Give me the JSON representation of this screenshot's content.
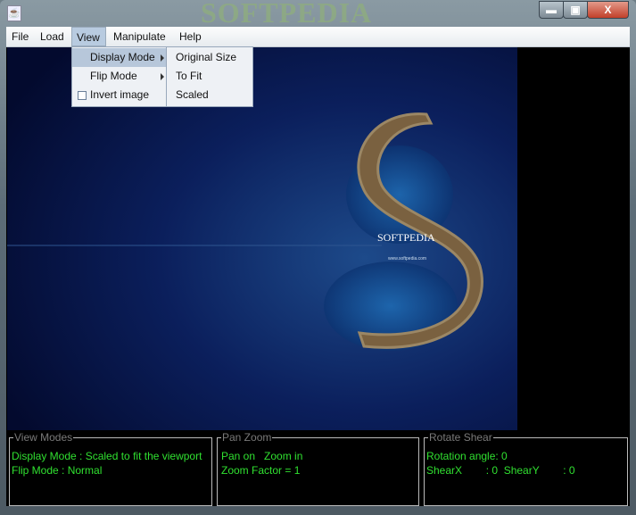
{
  "window": {
    "watermark": "SOFTPEDIA",
    "minimize": "▬",
    "maximize": "▣",
    "close": "X"
  },
  "menu": [
    "File",
    "Load",
    "View",
    "Manipulate",
    "Help"
  ],
  "view_menu": {
    "items": [
      {
        "label": "Display Mode"
      },
      {
        "label": "Flip Mode"
      },
      {
        "label": "Invert image",
        "checked": false
      }
    ]
  },
  "display_submenu": [
    "Original Size",
    "To Fit",
    "Scaled"
  ],
  "image": {
    "brand": "SOFTPEDIA",
    "url": "www.softpedia.com"
  },
  "panels": {
    "view_modes": {
      "title": "View Modes",
      "line1": "Display Mode : Scaled to fit the viewport",
      "line2": "Flip Mode : Normal"
    },
    "pan_zoom": {
      "title": "Pan Zoom",
      "line1": "Pan on   Zoom in",
      "line2": "Zoom Factor = 1"
    },
    "rotate_shear": {
      "title": "Rotate Shear",
      "line1": "Rotation angle: 0",
      "line2": "ShearX        : 0  ShearY        : 0"
    }
  }
}
